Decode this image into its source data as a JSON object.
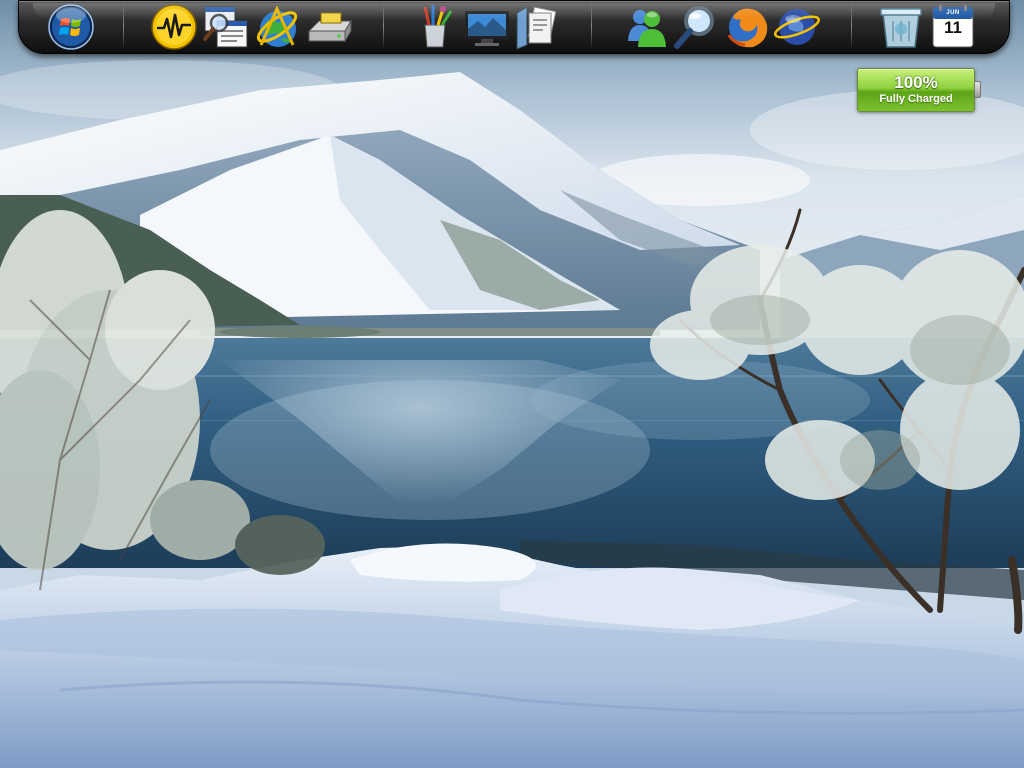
{
  "dock": {
    "icons": [
      {
        "name": "start-orb-icon",
        "glyph": "windows-logo"
      },
      {
        "name": "activity-monitor-icon",
        "glyph": "waveform"
      },
      {
        "name": "process-explorer-icon",
        "glyph": "window-magnifier"
      },
      {
        "name": "internet-globe-icon",
        "glyph": "globe-ring"
      },
      {
        "name": "drive-icon",
        "glyph": "hard-drive"
      },
      {
        "name": "paint-tools-icon",
        "glyph": "brushes-cup"
      },
      {
        "name": "display-settings-icon",
        "glyph": "monitor"
      },
      {
        "name": "documents-icon",
        "glyph": "papers"
      },
      {
        "name": "messenger-icon",
        "glyph": "users"
      },
      {
        "name": "search-icon",
        "glyph": "magnifier"
      },
      {
        "name": "firefox-icon",
        "glyph": "firefox"
      },
      {
        "name": "network-globe-icon",
        "glyph": "globe-orbit"
      },
      {
        "name": "recycle-bin-icon",
        "glyph": "glass-bin"
      },
      {
        "name": "calendar-icon",
        "glyph": "calendar"
      }
    ],
    "calendar": {
      "month": "JUN",
      "day": "11"
    }
  },
  "battery": {
    "percent": "100%",
    "status": "Fully Charged",
    "level": 1.0
  },
  "colors": {
    "dock_bg": "#1a1a1a",
    "battery_green": "#7cc22e",
    "sky": "#c9d8e6",
    "water": "#3f6f92",
    "snow": "#eef3fa"
  }
}
